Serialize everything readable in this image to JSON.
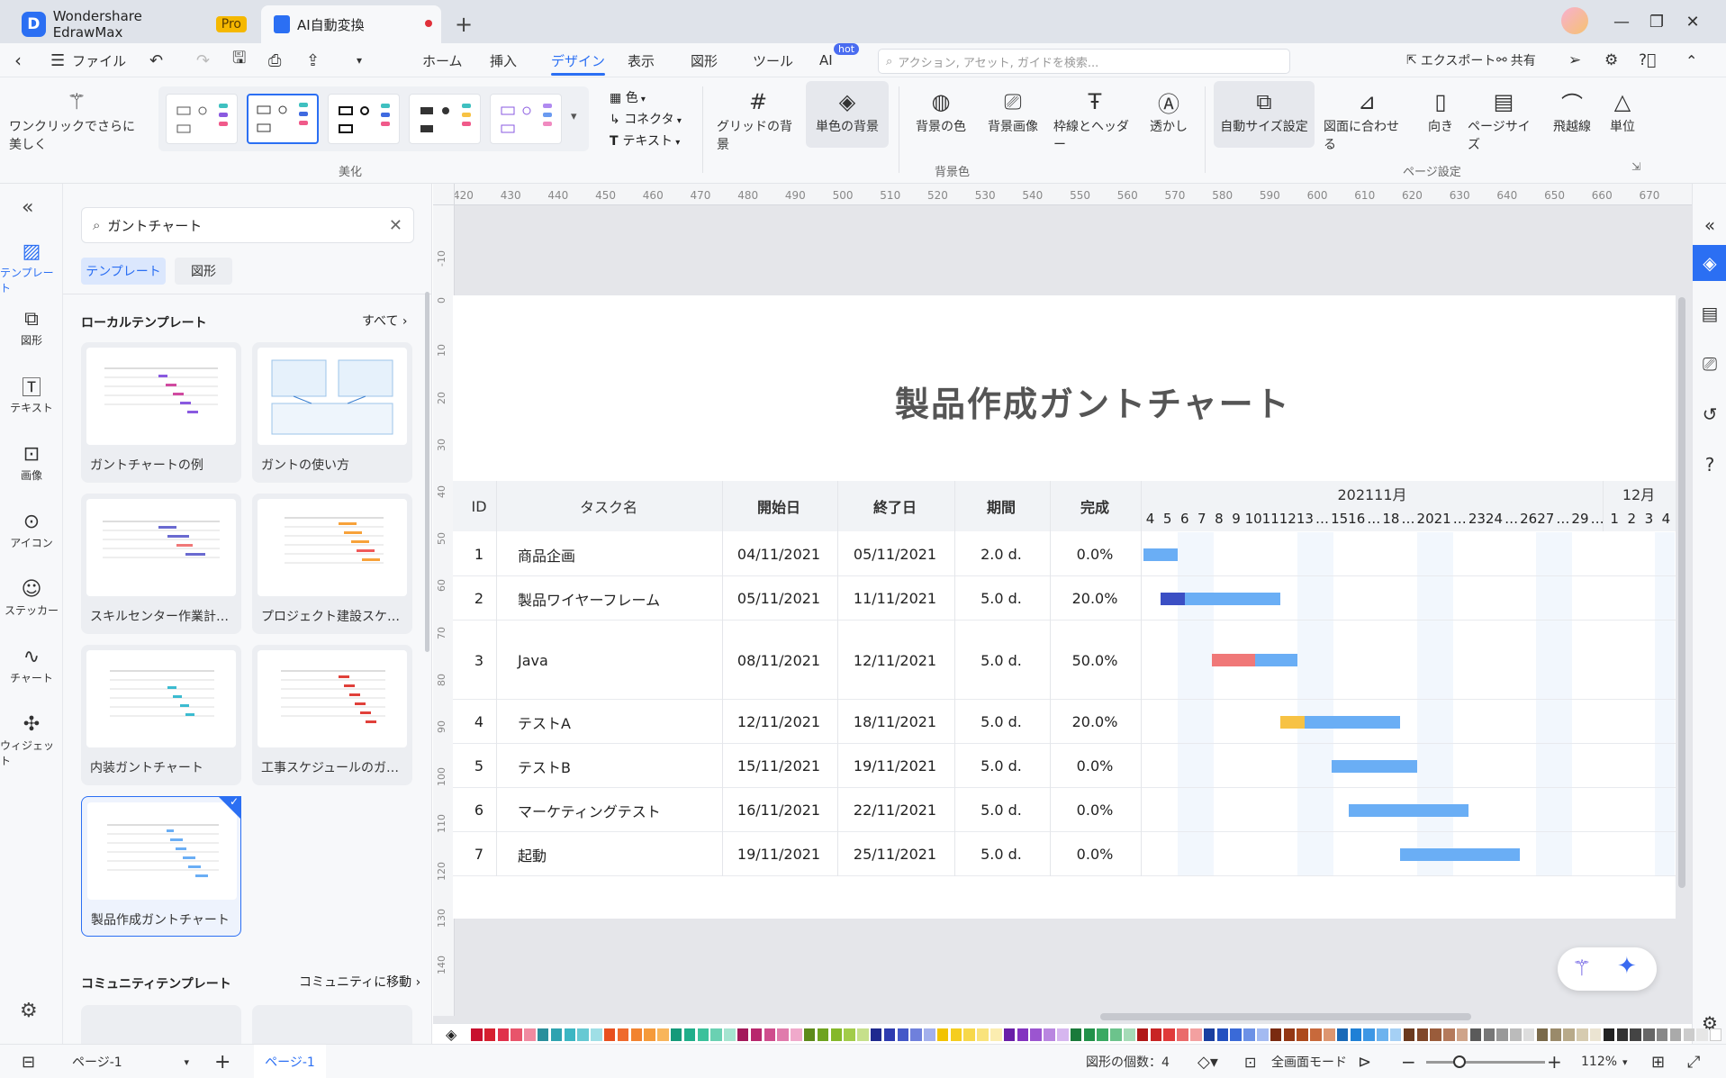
{
  "tabs": {
    "app_name": "Wondershare EdrawMax",
    "pro_badge": "Pro",
    "doc_tab": "AI自動変換",
    "new_tab": "+"
  },
  "menu": {
    "file": "ファイル",
    "items": [
      "ホーム",
      "挿入",
      "デザイン",
      "表示",
      "図形",
      "ツール",
      "AI"
    ],
    "ai_badge": "hot",
    "search_placeholder": "アクション, アセット, ガイドを検索...",
    "export": "エクスポート",
    "share": "共有"
  },
  "ribbon": {
    "beautify": "ワンクリックでさらに美しく",
    "color": "色",
    "connector": "コネクタ",
    "text": "テキスト",
    "group_beautify": "美化",
    "grid_bg": "グリッドの背景",
    "solid_bg": "単色の背景",
    "bg_color": "背景の色",
    "bg_image": "背景画像",
    "border_header": "枠線とヘッダー",
    "watermark": "透かし",
    "group_bg": "背景色",
    "auto_size": "自動サイズ設定",
    "fit_drawing": "図面に合わせる",
    "orientation": "向き",
    "page_size": "ページサイズ",
    "jump_line": "飛越線",
    "unit": "単位",
    "group_page": "ページ設定"
  },
  "leftbar": [
    "テンプレート",
    "図形",
    "テキスト",
    "画像",
    "アイコン",
    "ステッカー",
    "チャート",
    "ウィジェット"
  ],
  "panel": {
    "search_value": "ガントチャート",
    "tab_template": "テンプレート",
    "tab_shape": "図形",
    "local_title": "ローカルテンプレート",
    "all_link": "すべて",
    "cards": [
      "ガントチャートの例",
      "ガントの使い方",
      "スキルセンター作業計画...",
      "プロジェクト建設スケジュール",
      "内装ガントチャート",
      "工事スケジュールのガント...",
      "製品作成ガントチャート"
    ],
    "community_title": "コミュニティテンプレート",
    "community_link": "コミュニティに移動"
  },
  "ruler_h": [
    "420",
    "430",
    "440",
    "450",
    "460",
    "470",
    "480",
    "490",
    "500",
    "510",
    "520",
    "530",
    "540",
    "550",
    "560",
    "570",
    "580",
    "590",
    "600",
    "610",
    "620",
    "630",
    "640",
    "650",
    "660",
    "670"
  ],
  "ruler_v": [
    "-10",
    "0",
    "10",
    "20",
    "30",
    "40",
    "50",
    "60",
    "70",
    "80",
    "90",
    "100",
    "110",
    "120",
    "130",
    "140"
  ],
  "gantt": {
    "title": "製品作成ガントチャート",
    "headers": [
      "ID",
      "タスク名",
      "開始日",
      "終了日",
      "期間",
      "完成"
    ],
    "month_nov": "202111月",
    "month_dec": "12月",
    "days": [
      "4",
      "5",
      "6",
      "7",
      "8",
      "9",
      "10",
      "11",
      "12",
      "13",
      "…",
      "15",
      "16",
      "…",
      "18",
      "…",
      "20",
      "21",
      "…",
      "23",
      "24",
      "…",
      "26",
      "27",
      "…",
      "29",
      "…",
      "1",
      "2",
      "3",
      "4"
    ],
    "rows": [
      {
        "id": "1",
        "name": "商品企画",
        "start": "04/11/2021",
        "end": "05/11/2021",
        "dur": "2.0 d.",
        "done": "0.0%"
      },
      {
        "id": "2",
        "name": "製品ワイヤーフレーム",
        "start": "05/11/2021",
        "end": "11/11/2021",
        "dur": "5.0 d.",
        "done": "20.0%"
      },
      {
        "id": "3",
        "name": "Java",
        "start": "08/11/2021",
        "end": "12/11/2021",
        "dur": "5.0 d.",
        "done": "50.0%"
      },
      {
        "id": "4",
        "name": "テストA",
        "start": "12/11/2021",
        "end": "18/11/2021",
        "dur": "5.0 d.",
        "done": "20.0%"
      },
      {
        "id": "5",
        "name": "テストB",
        "start": "15/11/2021",
        "end": "19/11/2021",
        "dur": "5.0 d.",
        "done": "0.0%"
      },
      {
        "id": "6",
        "name": "マーケティングテスト",
        "start": "16/11/2021",
        "end": "22/11/2021",
        "dur": "5.0 d.",
        "done": "0.0%"
      },
      {
        "id": "7",
        "name": "起動",
        "start": "19/11/2021",
        "end": "25/11/2021",
        "dur": "5.0 d.",
        "done": "0.0%"
      }
    ],
    "bar_color": "#6aaef5",
    "progress_colors": [
      "#6aaef5",
      "#3b4fc4",
      "#f07878",
      "#f7c244",
      "#6aaef5",
      "#6aaef5",
      "#6aaef5"
    ]
  },
  "status": {
    "page_select": "ページ-1",
    "page_tab": "ページ-1",
    "shape_count": "図形の個数：4",
    "fullscreen": "全画面モード",
    "zoom": "112%"
  },
  "palette": [
    "#c8102e",
    "#d6202f",
    "#e0314b",
    "#e8546b",
    "#f08aa0",
    "#2a8f9c",
    "#2ea3b0",
    "#3bb6c3",
    "#66c9d3",
    "#9fdfe6",
    "#e8501f",
    "#ef6a2d",
    "#f2832f",
    "#f59a3a",
    "#f8b55b",
    "#159a7a",
    "#1fae8a",
    "#3bc19b",
    "#6ad1b2",
    "#a5e4d0",
    "#a3195b",
    "#b8276d",
    "#cf4d8d",
    "#e07bac",
    "#f0a9cb",
    "#5d8a1a",
    "#6ea31f",
    "#85b82a",
    "#a2cc4a",
    "#c6e08b",
    "#1f2a8f",
    "#2d3bb0",
    "#4458c8",
    "#6f80dc",
    "#a3b0ec",
    "#f2c300",
    "#f5cd1f",
    "#f7d84a",
    "#f9e37c",
    "#fbedb0",
    "#6a1fa8",
    "#8333c0",
    "#9b55d0",
    "#b986e0",
    "#d6b6ef",
    "#1a7a3a",
    "#22914a",
    "#3aa963",
    "#6cc38c",
    "#a5dbb7",
    "#b01818",
    "#c82424",
    "#e03a3a",
    "#ea6b6b",
    "#f3a0a0",
    "#1a3fa0",
    "#2351c0",
    "#3a6ad8",
    "#6c91e6",
    "#a3baf1",
    "#7a2a10",
    "#933714",
    "#ad4a1d",
    "#c8693b",
    "#dd9670",
    "#1a6ab8",
    "#1f80d6",
    "#3d97e5",
    "#6db3ee",
    "#a5d0f5",
    "#6b3a1f",
    "#80472a",
    "#9a5c3b",
    "#b47a5c",
    "#cfa48a",
    "#5a5a5a",
    "#777777",
    "#999999",
    "#bbbbbb",
    "#dddddd",
    "#7a6a4a",
    "#9a8a6a",
    "#b8aa8a",
    "#d6cbb0",
    "#ebe4d2",
    "#222222",
    "#333333",
    "#444444",
    "#666666",
    "#888888",
    "#aaaaaa",
    "#cccccc",
    "#e6e6e6",
    "#ffffff"
  ]
}
